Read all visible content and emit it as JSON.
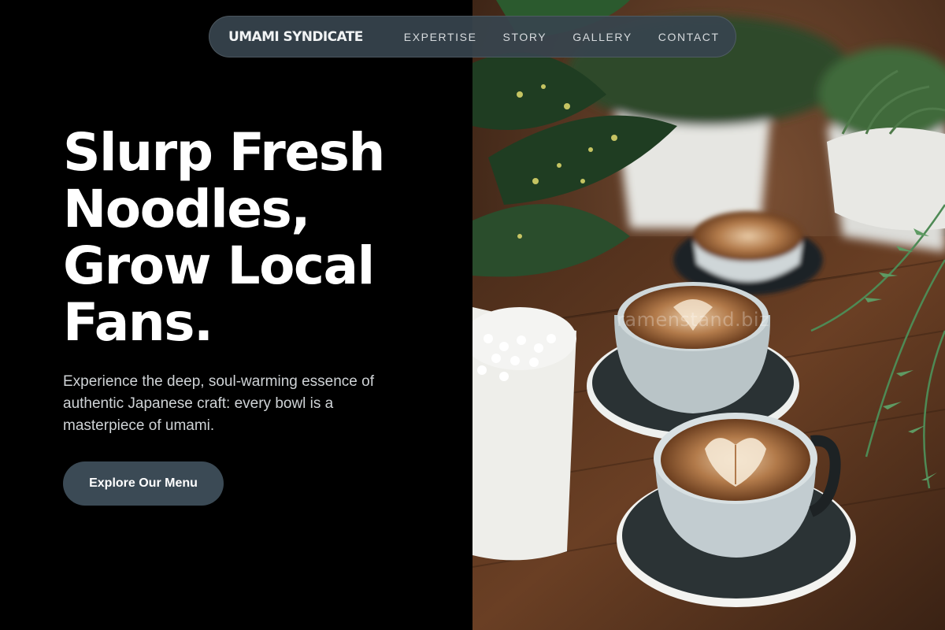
{
  "nav": {
    "brand": "UMAMI SYNDICATE",
    "links": [
      "EXPERTISE",
      "STORY",
      "GALLERY",
      "CONTACT"
    ]
  },
  "hero": {
    "title_lines": [
      "Slurp Fresh",
      "Noodles,",
      "Grow Local",
      "Fans."
    ],
    "subtitle": "Experience the deep, soul-warming essence of authentic Japanese craft: every bowl is a masterpiece of umami.",
    "cta_label": "Explore Our Menu"
  },
  "image": {
    "watermark": "ramenstand.biz"
  },
  "colors": {
    "background": "#000000",
    "nav_bg": "#37444e",
    "cta_bg": "#3b4a55",
    "text_primary": "#ffffff",
    "text_secondary": "#cfd3d6"
  }
}
